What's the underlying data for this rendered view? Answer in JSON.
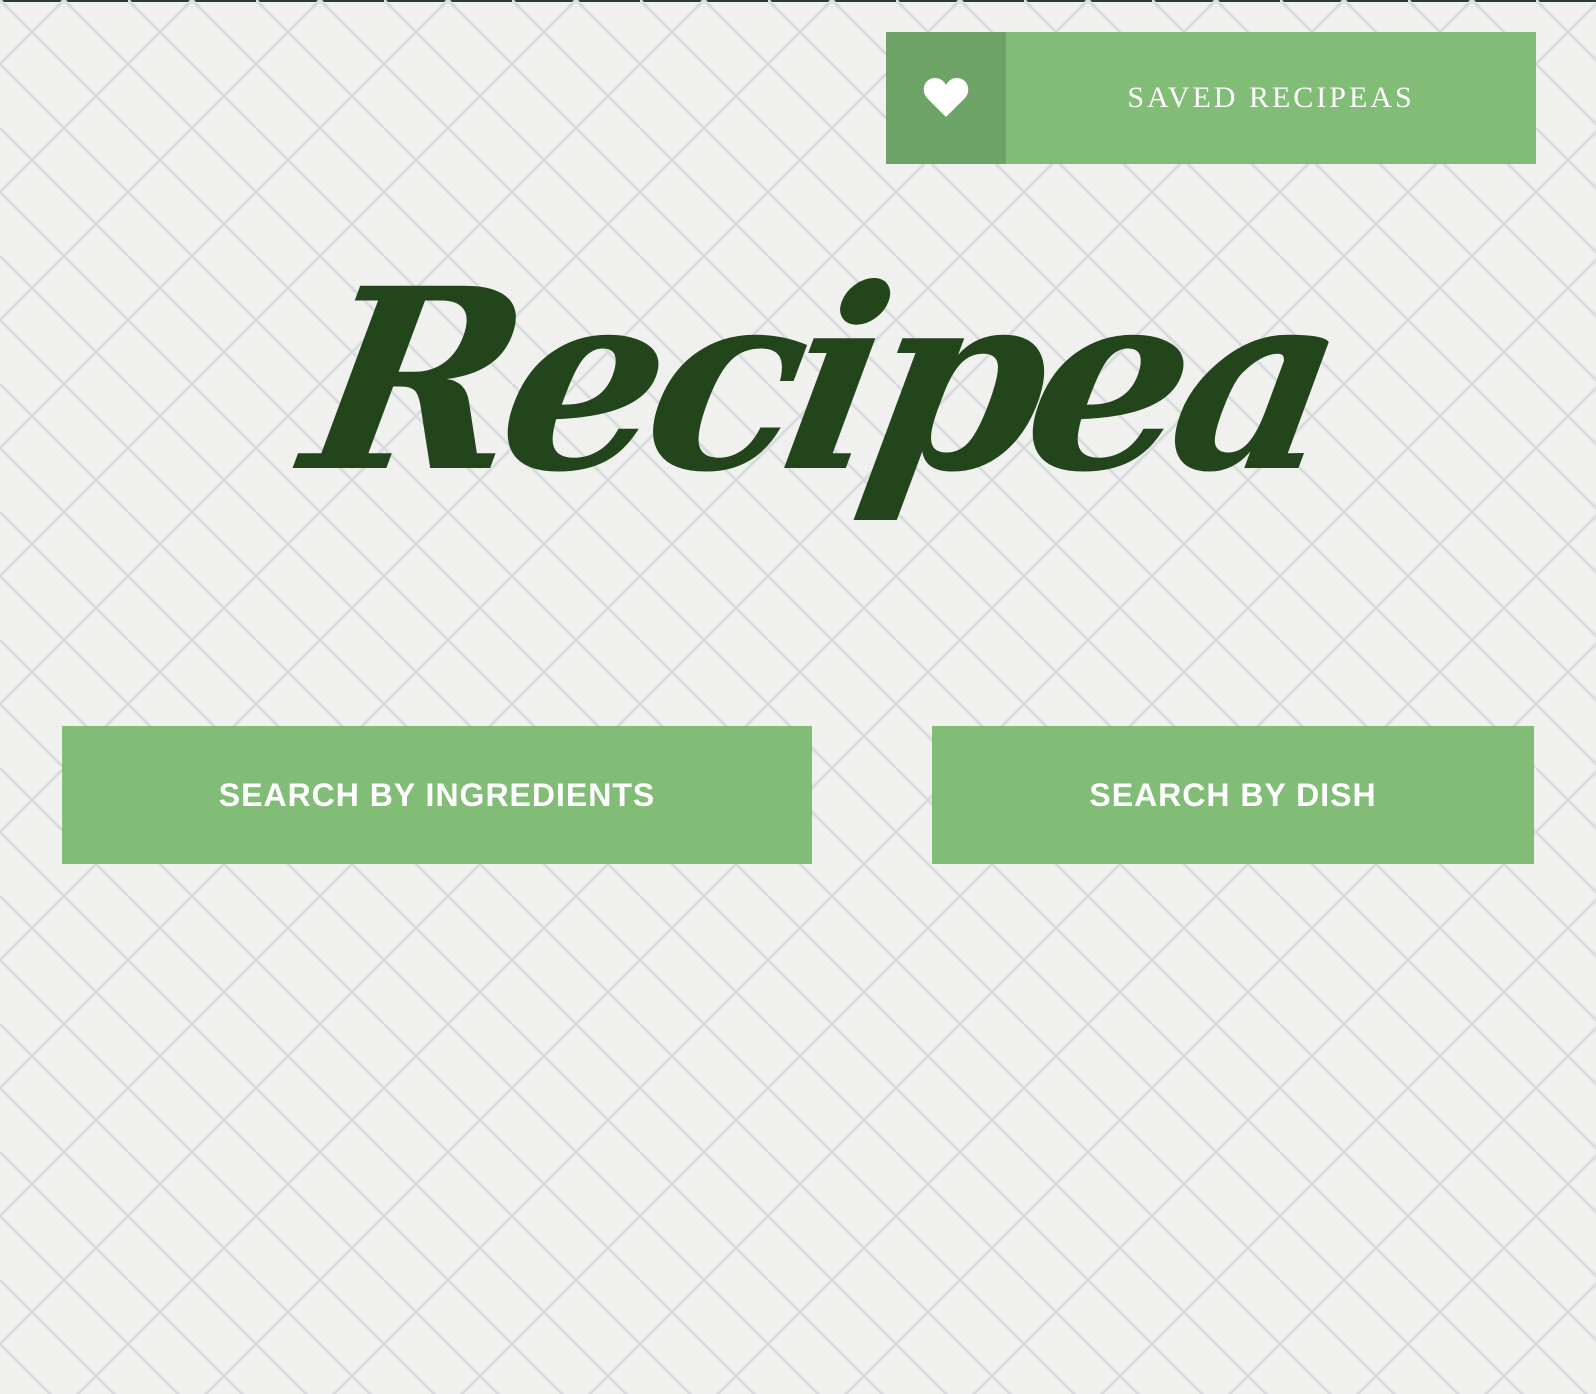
{
  "header": {
    "saved_button": {
      "icon": "heart-icon",
      "label": "SAVED RECIPEAS"
    }
  },
  "hero": {
    "logo_text": "Recipea"
  },
  "search": {
    "by_ingredients_label": "SEARCH BY INGREDIENTS",
    "by_dish_label": "SEARCH BY DISH"
  },
  "colors": {
    "background": "#f0f0ee",
    "pattern_line": "#d8dcdf",
    "button_green": "#82bd78",
    "icon_box_green": "#6ea367",
    "logo_green": "#23451b",
    "button_text": "#ffffff"
  }
}
